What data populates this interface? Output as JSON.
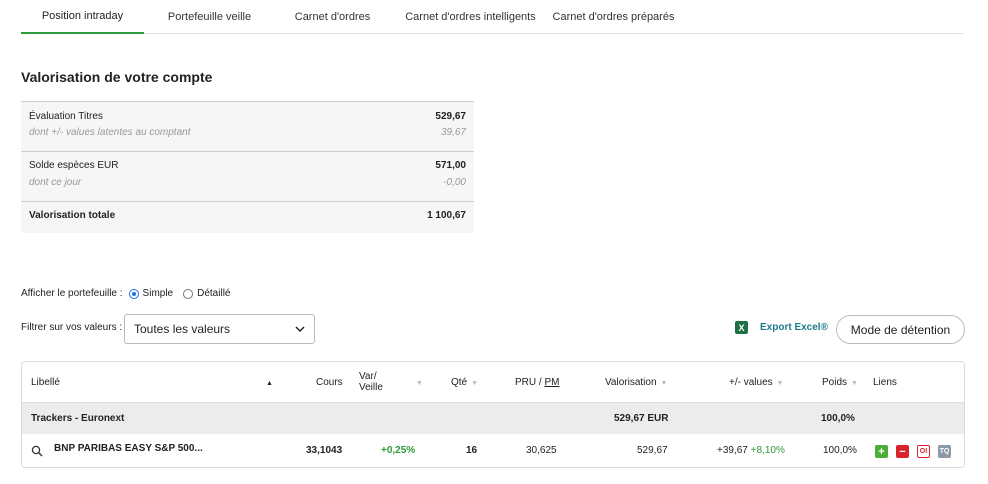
{
  "tabs": [
    {
      "label": "Position intraday",
      "active": true
    },
    {
      "label": "Portefeuille veille",
      "active": false
    },
    {
      "label": "Carnet d'ordres",
      "active": false
    },
    {
      "label": "Carnet d'ordres intelligents",
      "active": false
    },
    {
      "label": "Carnet d'ordres préparés",
      "active": false
    }
  ],
  "valuation": {
    "title": "Valorisation de votre compte",
    "securities_label": "Évaluation Titres",
    "securities_value": "529,67",
    "latent_label": "dont +/- values latentes au comptant",
    "latent_value": "39,67",
    "cash_label": "Solde espèces EUR",
    "cash_value": "571,00",
    "today_label": "dont ce jour",
    "today_value": "-0,00",
    "total_label": "Valorisation totale",
    "total_value": "1 100,67"
  },
  "display": {
    "label": "Afficher le portefeuille :",
    "option_simple": "Simple",
    "option_detail": "Détaillé",
    "selected": "Simple"
  },
  "filter": {
    "label": "Filtrer sur vos valeurs :",
    "selected": "Toutes les valeurs"
  },
  "export_label": "Export Excel®",
  "mode_button": "Mode de détention",
  "table": {
    "headers": {
      "libelle": "Libellé",
      "cours": "Cours",
      "var_line1": "Var/",
      "var_line2": "Veille",
      "qte": "Qté",
      "pru": "PRU /",
      "pm": "PM",
      "valorisation": "Valorisation",
      "plus_minus": "+/- values",
      "poids": "Poids",
      "liens": "Liens"
    },
    "group": {
      "name": "Trackers - Euronext",
      "valorisation": "529,67 EUR",
      "poids": "100,0%"
    },
    "rows": [
      {
        "libelle": "BNP PARIBAS EASY S&P 500...",
        "cours": "33,1043",
        "var": "+0,25%",
        "qte": "16",
        "pru": "30,625",
        "valorisation": "529,67",
        "pv_value": "+39,67",
        "pv_percent": "+8,10%",
        "poids": "100,0%",
        "links": [
          "+",
          "−",
          "OI",
          "TQ"
        ]
      }
    ]
  },
  "colors": {
    "accent_green": "#2e9a3c",
    "sell_red": "#d9232d",
    "excel_green": "#1e7145",
    "radio_blue": "#1a73e8"
  }
}
